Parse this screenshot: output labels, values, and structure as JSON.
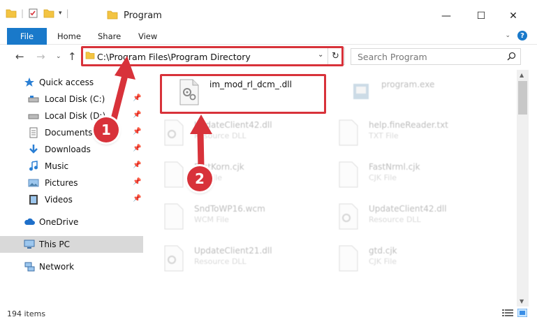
{
  "window": {
    "title": "Program",
    "minimize_glyph": "—",
    "maximize_glyph": "☐",
    "close_glyph": "✕"
  },
  "ribbon": {
    "file": "File",
    "home": "Home",
    "share": "Share",
    "view": "View"
  },
  "address": {
    "path": "C:\\Program Files\\Program Directory",
    "search_placeholder": "Search Program"
  },
  "sidebar": {
    "quick_access": "Quick access",
    "items": [
      {
        "label": "Local Disk (C:)",
        "icon": "drive-icon"
      },
      {
        "label": "Local Disk (D:)",
        "icon": "drive-icon"
      },
      {
        "label": "Documents",
        "icon": "documents-icon"
      },
      {
        "label": "Downloads",
        "icon": "downloads-icon"
      },
      {
        "label": "Music",
        "icon": "music-icon"
      },
      {
        "label": "Pictures",
        "icon": "pictures-icon"
      },
      {
        "label": "Videos",
        "icon": "videos-icon"
      }
    ],
    "onedrive": "OneDrive",
    "this_pc": "This PC",
    "network": "Network"
  },
  "files": {
    "highlighted": {
      "name": "im_mod_rl_dcm_.dll",
      "type": ""
    },
    "others": [
      {
        "name": "program.exe",
        "type": ""
      },
      {
        "name": "UpdateClient42.dll",
        "type": "Resource DLL"
      },
      {
        "name": "help.fineReader.txt",
        "type": "TXT File"
      },
      {
        "name": "FastKorn.cjk",
        "type": "CJK File"
      },
      {
        "name": "FastNrml.cjk",
        "type": "CJK File"
      },
      {
        "name": "SndToWP16.wcm",
        "type": "WCM File"
      },
      {
        "name": "UpdateClient42.dll",
        "type": "Resource DLL"
      },
      {
        "name": "UpdateClient21.dll",
        "type": "Resource DLL"
      },
      {
        "name": "gtd.cjk",
        "type": "CJK File"
      }
    ]
  },
  "status": {
    "count": "194 items"
  },
  "annotations": {
    "step1": "1",
    "step2": "2",
    "color": "#d8323a"
  },
  "colors": {
    "accent": "#1979ca",
    "highlight": "#d8323a",
    "selected": "#d9d9d9"
  }
}
